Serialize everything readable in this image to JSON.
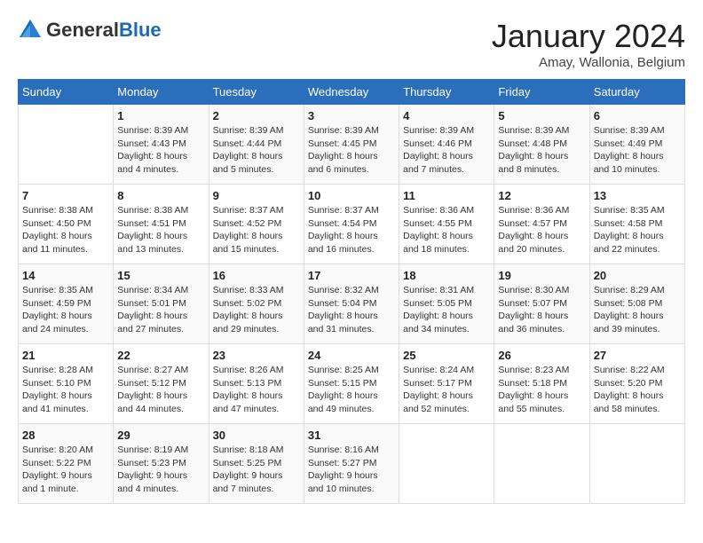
{
  "logo": {
    "general": "General",
    "blue": "Blue"
  },
  "header": {
    "month": "January 2024",
    "location": "Amay, Wallonia, Belgium"
  },
  "days_of_week": [
    "Sunday",
    "Monday",
    "Tuesday",
    "Wednesday",
    "Thursday",
    "Friday",
    "Saturday"
  ],
  "weeks": [
    [
      {
        "day": "",
        "sunrise": "",
        "sunset": "",
        "daylight": ""
      },
      {
        "day": "1",
        "sunrise": "Sunrise: 8:39 AM",
        "sunset": "Sunset: 4:43 PM",
        "daylight": "Daylight: 8 hours and 4 minutes."
      },
      {
        "day": "2",
        "sunrise": "Sunrise: 8:39 AM",
        "sunset": "Sunset: 4:44 PM",
        "daylight": "Daylight: 8 hours and 5 minutes."
      },
      {
        "day": "3",
        "sunrise": "Sunrise: 8:39 AM",
        "sunset": "Sunset: 4:45 PM",
        "daylight": "Daylight: 8 hours and 6 minutes."
      },
      {
        "day": "4",
        "sunrise": "Sunrise: 8:39 AM",
        "sunset": "Sunset: 4:46 PM",
        "daylight": "Daylight: 8 hours and 7 minutes."
      },
      {
        "day": "5",
        "sunrise": "Sunrise: 8:39 AM",
        "sunset": "Sunset: 4:48 PM",
        "daylight": "Daylight: 8 hours and 8 minutes."
      },
      {
        "day": "6",
        "sunrise": "Sunrise: 8:39 AM",
        "sunset": "Sunset: 4:49 PM",
        "daylight": "Daylight: 8 hours and 10 minutes."
      }
    ],
    [
      {
        "day": "7",
        "sunrise": "Sunrise: 8:38 AM",
        "sunset": "Sunset: 4:50 PM",
        "daylight": "Daylight: 8 hours and 11 minutes."
      },
      {
        "day": "8",
        "sunrise": "Sunrise: 8:38 AM",
        "sunset": "Sunset: 4:51 PM",
        "daylight": "Daylight: 8 hours and 13 minutes."
      },
      {
        "day": "9",
        "sunrise": "Sunrise: 8:37 AM",
        "sunset": "Sunset: 4:52 PM",
        "daylight": "Daylight: 8 hours and 15 minutes."
      },
      {
        "day": "10",
        "sunrise": "Sunrise: 8:37 AM",
        "sunset": "Sunset: 4:54 PM",
        "daylight": "Daylight: 8 hours and 16 minutes."
      },
      {
        "day": "11",
        "sunrise": "Sunrise: 8:36 AM",
        "sunset": "Sunset: 4:55 PM",
        "daylight": "Daylight: 8 hours and 18 minutes."
      },
      {
        "day": "12",
        "sunrise": "Sunrise: 8:36 AM",
        "sunset": "Sunset: 4:57 PM",
        "daylight": "Daylight: 8 hours and 20 minutes."
      },
      {
        "day": "13",
        "sunrise": "Sunrise: 8:35 AM",
        "sunset": "Sunset: 4:58 PM",
        "daylight": "Daylight: 8 hours and 22 minutes."
      }
    ],
    [
      {
        "day": "14",
        "sunrise": "Sunrise: 8:35 AM",
        "sunset": "Sunset: 4:59 PM",
        "daylight": "Daylight: 8 hours and 24 minutes."
      },
      {
        "day": "15",
        "sunrise": "Sunrise: 8:34 AM",
        "sunset": "Sunset: 5:01 PM",
        "daylight": "Daylight: 8 hours and 27 minutes."
      },
      {
        "day": "16",
        "sunrise": "Sunrise: 8:33 AM",
        "sunset": "Sunset: 5:02 PM",
        "daylight": "Daylight: 8 hours and 29 minutes."
      },
      {
        "day": "17",
        "sunrise": "Sunrise: 8:32 AM",
        "sunset": "Sunset: 5:04 PM",
        "daylight": "Daylight: 8 hours and 31 minutes."
      },
      {
        "day": "18",
        "sunrise": "Sunrise: 8:31 AM",
        "sunset": "Sunset: 5:05 PM",
        "daylight": "Daylight: 8 hours and 34 minutes."
      },
      {
        "day": "19",
        "sunrise": "Sunrise: 8:30 AM",
        "sunset": "Sunset: 5:07 PM",
        "daylight": "Daylight: 8 hours and 36 minutes."
      },
      {
        "day": "20",
        "sunrise": "Sunrise: 8:29 AM",
        "sunset": "Sunset: 5:08 PM",
        "daylight": "Daylight: 8 hours and 39 minutes."
      }
    ],
    [
      {
        "day": "21",
        "sunrise": "Sunrise: 8:28 AM",
        "sunset": "Sunset: 5:10 PM",
        "daylight": "Daylight: 8 hours and 41 minutes."
      },
      {
        "day": "22",
        "sunrise": "Sunrise: 8:27 AM",
        "sunset": "Sunset: 5:12 PM",
        "daylight": "Daylight: 8 hours and 44 minutes."
      },
      {
        "day": "23",
        "sunrise": "Sunrise: 8:26 AM",
        "sunset": "Sunset: 5:13 PM",
        "daylight": "Daylight: 8 hours and 47 minutes."
      },
      {
        "day": "24",
        "sunrise": "Sunrise: 8:25 AM",
        "sunset": "Sunset: 5:15 PM",
        "daylight": "Daylight: 8 hours and 49 minutes."
      },
      {
        "day": "25",
        "sunrise": "Sunrise: 8:24 AM",
        "sunset": "Sunset: 5:17 PM",
        "daylight": "Daylight: 8 hours and 52 minutes."
      },
      {
        "day": "26",
        "sunrise": "Sunrise: 8:23 AM",
        "sunset": "Sunset: 5:18 PM",
        "daylight": "Daylight: 8 hours and 55 minutes."
      },
      {
        "day": "27",
        "sunrise": "Sunrise: 8:22 AM",
        "sunset": "Sunset: 5:20 PM",
        "daylight": "Daylight: 8 hours and 58 minutes."
      }
    ],
    [
      {
        "day": "28",
        "sunrise": "Sunrise: 8:20 AM",
        "sunset": "Sunset: 5:22 PM",
        "daylight": "Daylight: 9 hours and 1 minute."
      },
      {
        "day": "29",
        "sunrise": "Sunrise: 8:19 AM",
        "sunset": "Sunset: 5:23 PM",
        "daylight": "Daylight: 9 hours and 4 minutes."
      },
      {
        "day": "30",
        "sunrise": "Sunrise: 8:18 AM",
        "sunset": "Sunset: 5:25 PM",
        "daylight": "Daylight: 9 hours and 7 minutes."
      },
      {
        "day": "31",
        "sunrise": "Sunrise: 8:16 AM",
        "sunset": "Sunset: 5:27 PM",
        "daylight": "Daylight: 9 hours and 10 minutes."
      },
      {
        "day": "",
        "sunrise": "",
        "sunset": "",
        "daylight": ""
      },
      {
        "day": "",
        "sunrise": "",
        "sunset": "",
        "daylight": ""
      },
      {
        "day": "",
        "sunrise": "",
        "sunset": "",
        "daylight": ""
      }
    ]
  ]
}
